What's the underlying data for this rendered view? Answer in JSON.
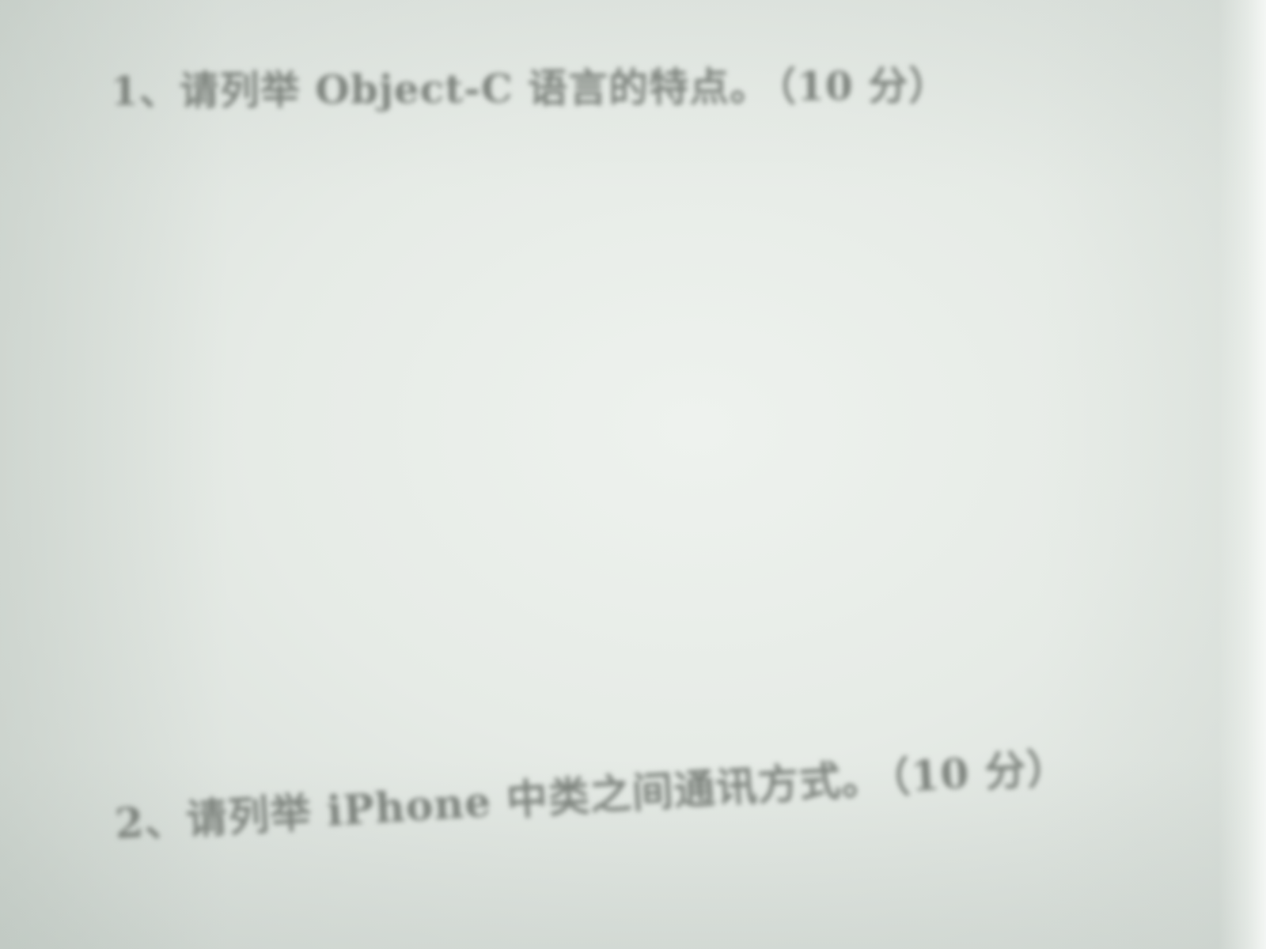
{
  "questions": [
    {
      "number": "1、",
      "text": "请列举 Object-C 语言的特点。",
      "score": "（10 分）"
    },
    {
      "number": "2、",
      "text": "请列举 iPhone 中类之间通讯方式。",
      "score": "（10 分）"
    }
  ]
}
